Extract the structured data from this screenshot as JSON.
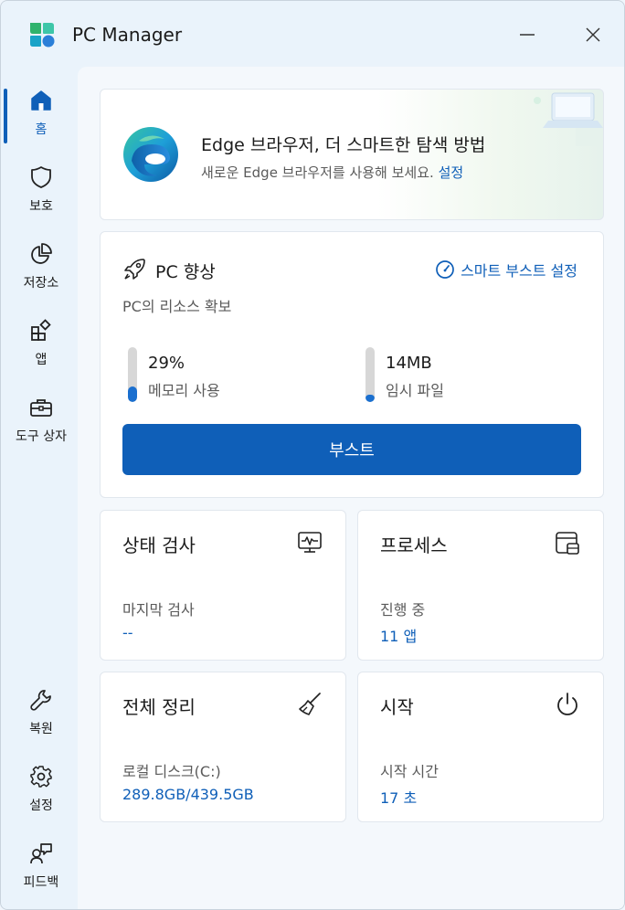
{
  "app": {
    "title": "PC Manager"
  },
  "sidebar": {
    "items": [
      {
        "label": "홈",
        "icon": "home-icon"
      },
      {
        "label": "보호",
        "icon": "shield-icon"
      },
      {
        "label": "저장소",
        "icon": "pie-chart-icon"
      },
      {
        "label": "앱",
        "icon": "apps-icon"
      },
      {
        "label": "도구 상자",
        "icon": "toolbox-icon"
      }
    ],
    "bottom_items": [
      {
        "label": "복원",
        "icon": "wrench-icon"
      },
      {
        "label": "설정",
        "icon": "gear-icon"
      },
      {
        "label": "피드백",
        "icon": "feedback-icon"
      }
    ],
    "active_index": 0
  },
  "banner": {
    "title": "Edge 브라우저, 더 스마트한 탐색 방법",
    "subtitle": "새로운 Edge 브라우저를 사용해 보세요.",
    "link": "설정"
  },
  "boost": {
    "title": "PC 향상",
    "smart_link": "스마트 부스트 설정",
    "description": "PC의 리소스 확보",
    "memory": {
      "value": "29%",
      "label": "메모리 사용",
      "fill_fraction": 0.29
    },
    "temp": {
      "value": "14MB",
      "label": "임시 파일",
      "fill_fraction": 0.1
    },
    "button_label": "부스트"
  },
  "tiles": {
    "health": {
      "title": "상태 검사",
      "label": "마지막 검사",
      "value": "--"
    },
    "process": {
      "title": "프로세스",
      "label": "진행 중",
      "value": "11 앱"
    },
    "cleanup": {
      "title": "전체 정리",
      "label": "로컬 디스크(C:)",
      "value": "289.8GB/439.5GB"
    },
    "startup": {
      "title": "시작",
      "label": "시작 시간",
      "value": "17 초"
    }
  },
  "colors": {
    "accent": "#0f5fb8",
    "meter_fill": "#1a6fcf",
    "meter_track": "#d7d7d7"
  }
}
